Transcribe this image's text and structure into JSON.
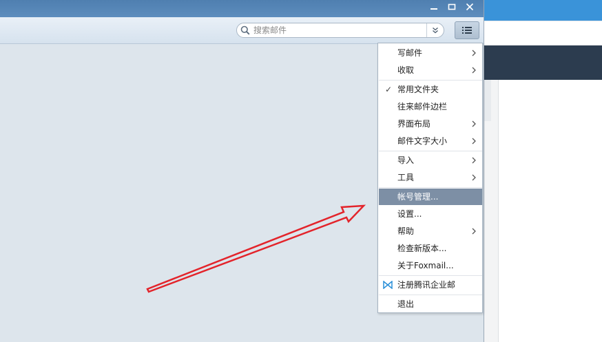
{
  "search": {
    "placeholder": "搜索邮件"
  },
  "window_controls": {
    "minimize": "▬",
    "maximize": "☐",
    "close": "✕"
  },
  "menu": {
    "items": [
      {
        "label": "写邮件",
        "submenu": true
      },
      {
        "label": "收取",
        "submenu": true
      },
      {
        "label": "常用文件夹",
        "checked": true
      },
      {
        "label": "往来邮件边栏"
      },
      {
        "label": "界面布局",
        "submenu": true
      },
      {
        "label": "邮件文字大小",
        "submenu": true
      },
      {
        "label": "导入",
        "submenu": true
      },
      {
        "label": "工具",
        "submenu": true
      },
      {
        "label": "帐号管理...",
        "highlighted": true
      },
      {
        "label": "设置..."
      },
      {
        "label": "帮助",
        "submenu": true
      },
      {
        "label": "检查新版本..."
      },
      {
        "label": "关于Foxmail..."
      },
      {
        "label": "注册腾讯企业邮",
        "icon": "tencent-exmail-icon"
      },
      {
        "label": "退出"
      }
    ]
  },
  "colors": {
    "titlebar": "#5384b5",
    "highlight": "#7d8fa5",
    "annotation_arrow": "#e3242b",
    "background_accent": "#3a93d9"
  }
}
